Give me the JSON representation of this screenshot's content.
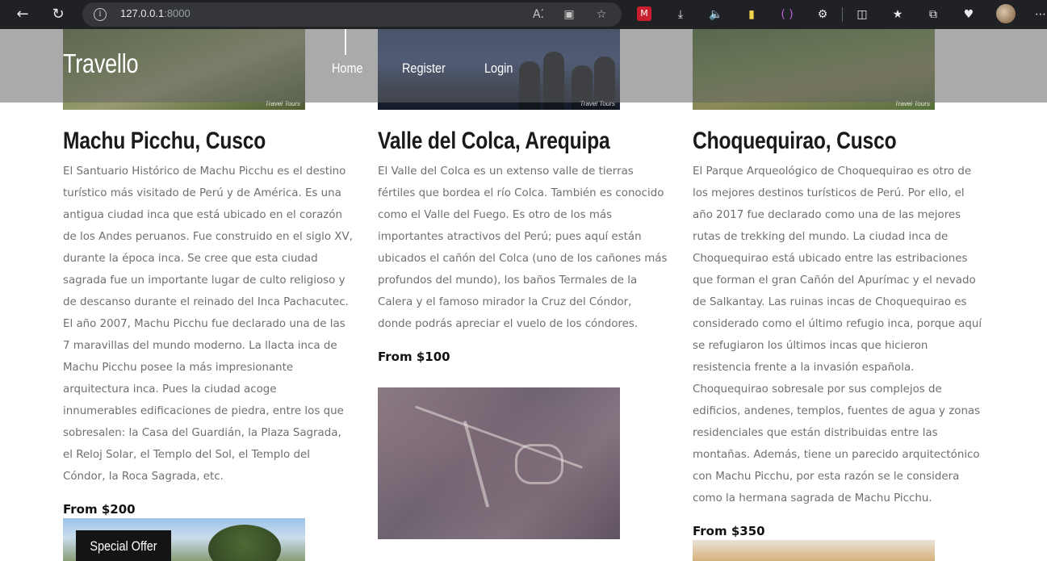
{
  "browser": {
    "url_host": "127.0.0.1",
    "url_port": ":8000",
    "icons": [
      "back-icon",
      "reload-icon",
      "site-info-icon",
      "read-aloud-icon",
      "immersive-reader-icon",
      "favorite-star-icon",
      "extension-red-icon",
      "download-icon",
      "mute-icon",
      "extension-card-icon",
      "extension-purple-icon",
      "extensions-puzzle-icon",
      "split-screen-icon",
      "favorites-icon",
      "collections-icon",
      "performance-icon",
      "profile-avatar-icon",
      "more-menu-icon"
    ]
  },
  "header": {
    "brand": "Travello",
    "nav": [
      {
        "label": "Home"
      },
      {
        "label": "Register"
      },
      {
        "label": "Login"
      }
    ]
  },
  "destinations": [
    {
      "title": "Machu Picchu, Cusco",
      "description": "El Santuario Histórico de Machu Picchu es el destino turístico más visitado de Perú y de América. Es una antigua ciudad inca que está ubicado en el corazón de los Andes peruanos. Fue construido en el siglo XV, durante la época inca. Se cree que esta ciudad sagrada fue un importante lugar de culto religioso y de descanso durante el reinado del Inca Pachacutec. El año 2007, Machu Picchu fue declarado una de las 7 maravillas del mundo moderno. La llacta inca de Machu Picchu posee la más impresionante arquitectura inca. Pues la ciudad acoge innumerables edificaciones de piedra, entre los que sobresalen: la Casa del Guardián, la Plaza Sagrada, el Reloj Solar, el Templo del Sol, el Templo del Cóndor, la Roca Sagrada, etc.",
      "price": "From $200",
      "watermark": "Travel Tours"
    },
    {
      "title": "Valle del Colca, Arequipa",
      "description": "El Valle del Colca es un extenso valle de tierras fértiles que bordea el río Colca. También es conocido como el Valle del Fuego. Es otro de los más importantes atractivos del Perú; pues aquí están ubicados el cañón del Colca (uno de los cañones más profundos del mundo), los baños Termales de la Calera y el famoso mirador la Cruz del Cóndor, donde podrás apreciar el vuelo de los cóndores.",
      "price": "From $100",
      "watermark": "Travel Tours"
    },
    {
      "title": "Choquequirao, Cusco",
      "description": "El Parque Arqueológico de Choquequirao es otro de los mejores destinos turísticos de Perú. Por ello, el año 2017 fue declarado como una de las mejores rutas de trekking del mundo. La ciudad inca de Choquequirao está ubicado entre las estribaciones que forman el gran Cañón del Apurímac y el nevado de Salkantay. Las ruinas incas de Choquequirao es considerado como el último refugio inca, porque aquí se refugiaron los últimos incas que hicieron resistencia frente a la invasión española. Choquequirao sobresale por sus complejos de edificios, andenes, templos, fuentes de agua y zonas residenciales que están distribuidas entre las montañas. Además, tiene un parecido arquitectónico con Machu Picchu, por esta razón se le considera como la hermana sagrada de Machu Picchu.",
      "price": "From $350",
      "watermark": "Travel Tours"
    }
  ],
  "special_offer": {
    "label": "Special Offer"
  }
}
